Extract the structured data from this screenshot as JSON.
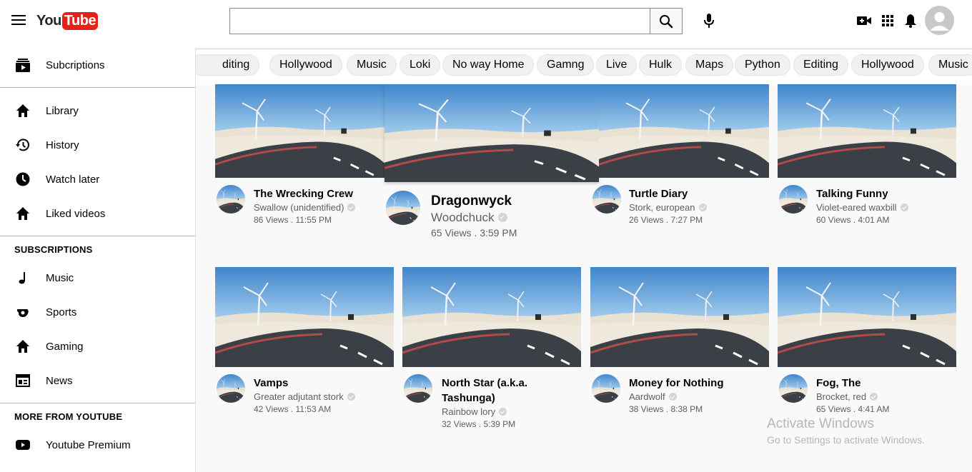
{
  "header": {
    "logo_you": "You",
    "logo_tube": "Tube",
    "search_value": "",
    "search_placeholder": ""
  },
  "sidebar": {
    "items_top": [
      {
        "label": "Subcriptions",
        "icon": "subscriptions-icon"
      }
    ],
    "items_library": [
      {
        "label": "Library",
        "icon": "home-icon"
      },
      {
        "label": "History",
        "icon": "history-icon"
      },
      {
        "label": "Watch later",
        "icon": "clock-icon"
      },
      {
        "label": "Liked videos",
        "icon": "home-icon"
      }
    ],
    "subscriptions_heading": "SUBSCRIPTIONS",
    "subscriptions": [
      {
        "label": "Music",
        "icon": "music-note-icon"
      },
      {
        "label": "Sports",
        "icon": "sports-icon"
      },
      {
        "label": "Gaming",
        "icon": "home-icon"
      },
      {
        "label": "News",
        "icon": "news-icon"
      }
    ],
    "more_heading": "MORE FROM YOUTUBE",
    "more": [
      {
        "label": "Youtube Premium",
        "icon": "youtube-play-icon"
      }
    ]
  },
  "chips": [
    "diting",
    "Hollywood",
    "Music",
    "Loki",
    "No way Home",
    "Gamng",
    "Live",
    "Hulk",
    "Maps",
    "Python",
    "Editing",
    "Hollywood",
    "Music"
  ],
  "videos": [
    {
      "title": "The Wrecking Crew",
      "channel": "Swallow (unidentified)",
      "meta": "86 Views . 11:55 PM"
    },
    {
      "title": "Dragonwyck",
      "channel": "Woodchuck",
      "meta": "65 Views . 3:59 PM"
    },
    {
      "title": "Turtle Diary",
      "channel": "Stork, european",
      "meta": "26 Views . 7:27 PM"
    },
    {
      "title": "Talking Funny",
      "channel": "Violet-eared waxbill",
      "meta": "60 Views . 4:01 AM"
    },
    {
      "title": "Vamps",
      "channel": "Greater adjutant stork",
      "meta": "42 Views . 11:53 AM"
    },
    {
      "title": "North Star (a.k.a. Tashunga)",
      "channel": "Rainbow lory",
      "meta": "32 Views . 5:39 PM"
    },
    {
      "title": "Money for Nothing",
      "channel": "Aardwolf",
      "meta": "38 Views . 8:38 PM"
    },
    {
      "title": "Fog, The",
      "channel": "Brocket, red",
      "meta": "65 Views . 4:41 AM"
    }
  ],
  "watermark": {
    "line1": "Activate Windows",
    "line2": "Go to Settings to activate Windows."
  },
  "colors": {
    "brand_red": "#e62117",
    "sky": "#4f94d4",
    "road": "#3a3f45"
  }
}
